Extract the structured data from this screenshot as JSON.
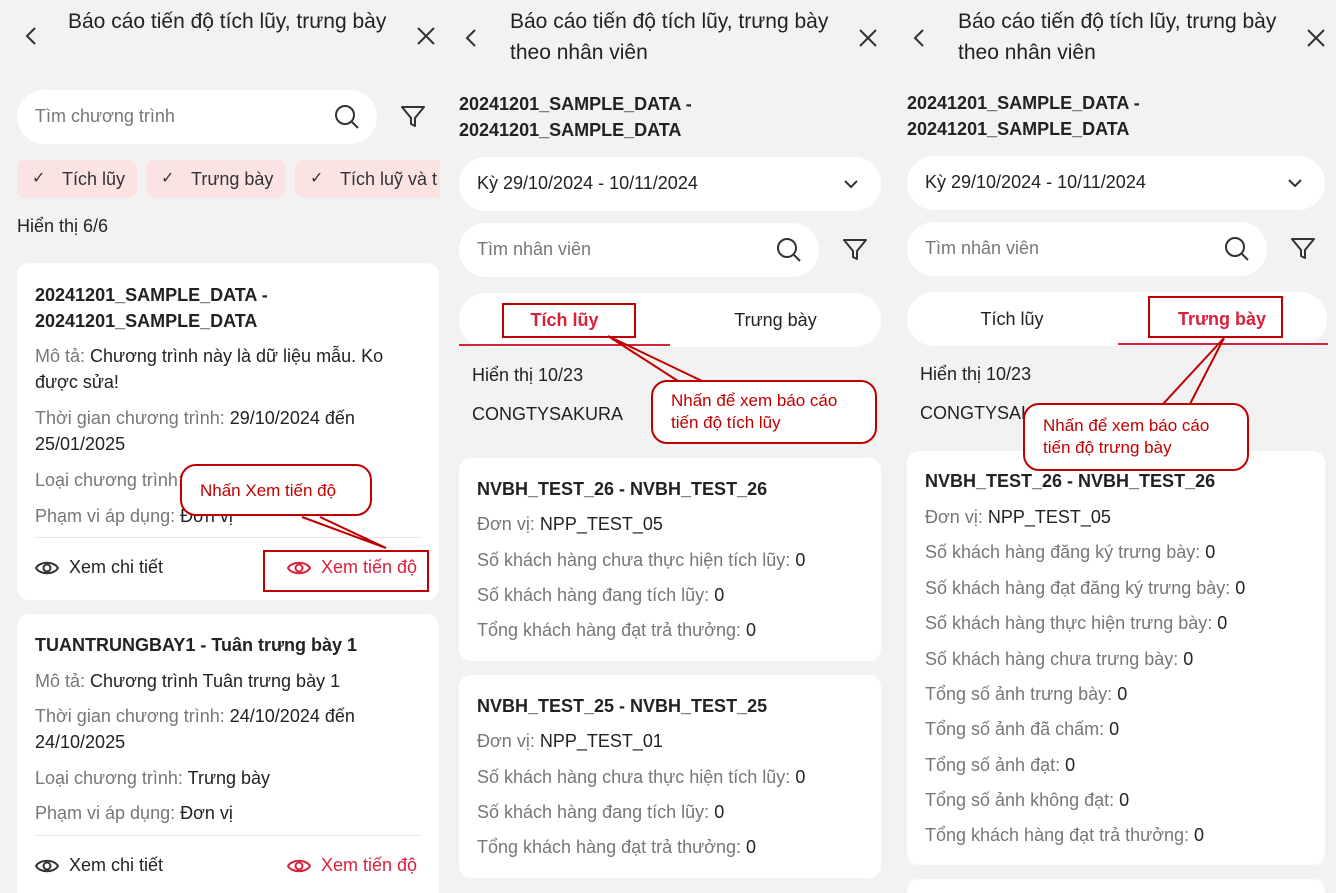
{
  "panel1": {
    "title": "Báo cáo tiến độ tích lũy, trưng bày",
    "search_placeholder": "Tìm chương trình",
    "chips": [
      "Tích lũy",
      "Trưng bày",
      "Tích luỹ và t"
    ],
    "count": "Hiển thị 6/6",
    "cards": [
      {
        "title_line1": "20241201_SAMPLE_DATA -",
        "title_line2": "20241201_SAMPLE_DATA",
        "desc_key": "Mô tả:",
        "desc_val_line1": "Chương trình này là dữ liệu mẫu. Ko",
        "desc_val_line2": "được sửa!",
        "time_key": "Thời gian chương trình:",
        "time_val_line1": "29/10/2024 đến",
        "time_val_line2": "25/01/2025",
        "type_key": "Loại chương trình:",
        "type_val": "",
        "scope_key": "Phạm vi áp dụng:",
        "scope_val": "Đơn vị",
        "detail": "Xem chi tiết",
        "progress": "Xem tiến độ"
      },
      {
        "title_line1": "TUANTRUNGBAY1 - Tuân trưng bày 1",
        "desc_key": "Mô tả:",
        "desc_val_line1": "Chương trình Tuân trưng bày 1",
        "time_key": "Thời gian chương trình:",
        "time_val_line1": "24/10/2024 đến",
        "time_val_line2": "24/10/2025",
        "type_key": "Loại chương trình:",
        "type_val": "Trưng bày",
        "scope_key": "Phạm vi áp dụng:",
        "scope_val": "Đơn vị",
        "detail": "Xem chi tiết",
        "progress": "Xem tiến độ"
      }
    ],
    "callout": "Nhấn Xem tiến độ"
  },
  "panel2": {
    "title": "Báo cáo tiến độ tích lũy, trưng bày theo nhân viên",
    "program_line1": "20241201_SAMPLE_DATA -",
    "program_line2": "20241201_SAMPLE_DATA",
    "period": "Kỳ 29/10/2024 - 10/11/2024",
    "search_placeholder": "Tìm nhân viên",
    "tabs": [
      "Tích lũy",
      "Trưng bày"
    ],
    "count": "Hiển thị 10/23",
    "company": "CONGTYSAKURA",
    "callout": "Nhấn để xem báo cáo tiến độ tích lũy",
    "cards": [
      {
        "title": "NVBH_TEST_26 - NVBH_TEST_26",
        "rows": [
          {
            "k": "Đơn vị:",
            "v": "NPP_TEST_05"
          },
          {
            "k": "Số khách hàng chưa thực hiện tích lũy:",
            "v": "0"
          },
          {
            "k": "Số khách hàng đang tích lũy:",
            "v": "0"
          },
          {
            "k": "Tổng khách hàng đạt trả thưởng:",
            "v": "0"
          }
        ]
      },
      {
        "title": "NVBH_TEST_25 - NVBH_TEST_25",
        "rows": [
          {
            "k": "Đơn vị:",
            "v": "NPP_TEST_01"
          },
          {
            "k": "Số khách hàng chưa thực hiện tích lũy:",
            "v": "0"
          },
          {
            "k": "Số khách hàng đang tích lũy:",
            "v": "0"
          },
          {
            "k": "Tổng khách hàng đạt trả thưởng:",
            "v": "0"
          }
        ]
      }
    ]
  },
  "panel3": {
    "title": "Báo cáo tiến độ tích lũy, trưng bày theo nhân viên",
    "program_line1": "20241201_SAMPLE_DATA -",
    "program_line2": "20241201_SAMPLE_DATA",
    "period": "Kỳ 29/10/2024 - 10/11/2024",
    "search_placeholder": "Tìm nhân viên",
    "tabs": [
      "Tích lũy",
      "Trưng bày"
    ],
    "count": "Hiển thị 10/23",
    "company": "CONGTYSAKURA",
    "callout": "Nhấn để xem báo cáo tiến độ trưng bày",
    "card": {
      "title": "NVBH_TEST_26 - NVBH_TEST_26",
      "rows": [
        {
          "k": "Đơn vị:",
          "v": "NPP_TEST_05"
        },
        {
          "k": "Số khách hàng đăng ký trưng bày:",
          "v": "0"
        },
        {
          "k": "Số khách hàng đạt đăng ký trưng bày:",
          "v": "0"
        },
        {
          "k": "Số khách hàng thực hiện trưng bày:",
          "v": "0"
        },
        {
          "k": "Số khách hàng chưa trưng bày:",
          "v": "0"
        },
        {
          "k": "Tổng số ảnh trưng bày:",
          "v": "0"
        },
        {
          "k": "Tổng số ảnh đã chấm:",
          "v": "0"
        },
        {
          "k": "Tổng số ảnh đạt:",
          "v": "0"
        },
        {
          "k": "Tổng số ảnh không đạt:",
          "v": "0"
        },
        {
          "k": "Tổng khách hàng đạt trả thưởng:",
          "v": "0"
        }
      ]
    }
  },
  "colors": {
    "accent": "#d6223a",
    "annotation": "#c00000",
    "chip_bg": "#fbe3e3",
    "panel_bg": "#f2f2f2"
  }
}
